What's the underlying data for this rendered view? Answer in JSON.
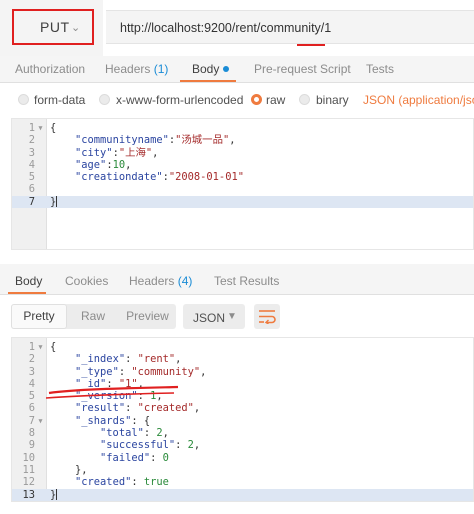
{
  "request": {
    "method": "PUT",
    "url": "http://localhost:9200/rent/community/1"
  },
  "request_tabs": [
    {
      "label": "Authorization"
    },
    {
      "label": "Headers",
      "count": "(1)"
    },
    {
      "label": "Body"
    },
    {
      "label": "Pre-request Script"
    },
    {
      "label": "Tests"
    }
  ],
  "body_types": {
    "form_data": "form-data",
    "urlencoded": "x-www-form-urlencoded",
    "raw": "raw",
    "binary": "binary",
    "content_type": "JSON (application/json)",
    "selected": "raw"
  },
  "request_body": {
    "line_numbers": [
      "1",
      "2",
      "3",
      "4",
      "5",
      "6",
      "7"
    ],
    "lines": [
      [
        {
          "t": "{",
          "c": "p"
        }
      ],
      [
        {
          "t": "    ",
          "c": "p"
        },
        {
          "t": "\"communityname\"",
          "c": "k"
        },
        {
          "t": ":",
          "c": "p"
        },
        {
          "t": "\"汤城一品\"",
          "c": "s"
        },
        {
          "t": ",",
          "c": "p"
        }
      ],
      [
        {
          "t": "    ",
          "c": "p"
        },
        {
          "t": "\"city\"",
          "c": "k"
        },
        {
          "t": ":",
          "c": "p"
        },
        {
          "t": "\"上海\"",
          "c": "s"
        },
        {
          "t": ",",
          "c": "p"
        }
      ],
      [
        {
          "t": "    ",
          "c": "p"
        },
        {
          "t": "\"age\"",
          "c": "k"
        },
        {
          "t": ":",
          "c": "p"
        },
        {
          "t": "10",
          "c": "n"
        },
        {
          "t": ",",
          "c": "p"
        }
      ],
      [
        {
          "t": "    ",
          "c": "p"
        },
        {
          "t": "\"creationdate\"",
          "c": "k"
        },
        {
          "t": ":",
          "c": "p"
        },
        {
          "t": "\"2008-01-01\"",
          "c": "s"
        }
      ],
      [],
      [
        {
          "t": "}",
          "c": "p"
        }
      ]
    ]
  },
  "response_tabs": [
    {
      "label": "Body"
    },
    {
      "label": "Cookies"
    },
    {
      "label": "Headers",
      "count": "(4)"
    },
    {
      "label": "Test Results"
    }
  ],
  "response_format": {
    "buttons": [
      "Pretty",
      "Raw",
      "Preview"
    ],
    "selected": "JSON"
  },
  "response_body": {
    "line_numbers": [
      "1",
      "2",
      "3",
      "4",
      "5",
      "6",
      "7",
      "8",
      "9",
      "10",
      "11",
      "12",
      "13"
    ],
    "lines": [
      [
        {
          "t": "{",
          "c": "p"
        }
      ],
      [
        {
          "t": "    ",
          "c": "p"
        },
        {
          "t": "\"_index\"",
          "c": "k"
        },
        {
          "t": ": ",
          "c": "p"
        },
        {
          "t": "\"rent\"",
          "c": "s"
        },
        {
          "t": ",",
          "c": "p"
        }
      ],
      [
        {
          "t": "    ",
          "c": "p"
        },
        {
          "t": "\"_type\"",
          "c": "k"
        },
        {
          "t": ": ",
          "c": "p"
        },
        {
          "t": "\"community\"",
          "c": "s"
        },
        {
          "t": ",",
          "c": "p"
        }
      ],
      [
        {
          "t": "    ",
          "c": "p"
        },
        {
          "t": "\"_id\"",
          "c": "k"
        },
        {
          "t": ": ",
          "c": "p"
        },
        {
          "t": "\"1\"",
          "c": "s"
        },
        {
          "t": ",",
          "c": "p"
        }
      ],
      [
        {
          "t": "    ",
          "c": "p"
        },
        {
          "t": "\"_version\"",
          "c": "k"
        },
        {
          "t": ": ",
          "c": "p"
        },
        {
          "t": "1",
          "c": "n"
        },
        {
          "t": ",",
          "c": "p"
        }
      ],
      [
        {
          "t": "    ",
          "c": "p"
        },
        {
          "t": "\"result\"",
          "c": "k"
        },
        {
          "t": ": ",
          "c": "p"
        },
        {
          "t": "\"created\"",
          "c": "s"
        },
        {
          "t": ",",
          "c": "p"
        }
      ],
      [
        {
          "t": "    ",
          "c": "p"
        },
        {
          "t": "\"_shards\"",
          "c": "k"
        },
        {
          "t": ": {",
          "c": "p"
        }
      ],
      [
        {
          "t": "        ",
          "c": "p"
        },
        {
          "t": "\"total\"",
          "c": "k"
        },
        {
          "t": ": ",
          "c": "p"
        },
        {
          "t": "2",
          "c": "n"
        },
        {
          "t": ",",
          "c": "p"
        }
      ],
      [
        {
          "t": "        ",
          "c": "p"
        },
        {
          "t": "\"successful\"",
          "c": "k"
        },
        {
          "t": ": ",
          "c": "p"
        },
        {
          "t": "2",
          "c": "n"
        },
        {
          "t": ",",
          "c": "p"
        }
      ],
      [
        {
          "t": "        ",
          "c": "p"
        },
        {
          "t": "\"failed\"",
          "c": "k"
        },
        {
          "t": ": ",
          "c": "p"
        },
        {
          "t": "0",
          "c": "n"
        }
      ],
      [
        {
          "t": "    },",
          "c": "p"
        }
      ],
      [
        {
          "t": "    ",
          "c": "p"
        },
        {
          "t": "\"created\"",
          "c": "k"
        },
        {
          "t": ": ",
          "c": "p"
        },
        {
          "t": "true",
          "c": "n"
        }
      ],
      [
        {
          "t": "}",
          "c": "p"
        }
      ]
    ]
  },
  "icons": {
    "method_dropdown": "chevron-down-icon",
    "select_dropdown": "chevron-down-icon",
    "wrap_lines": "wrap-lines-icon",
    "body_modified": "dot-indicator-icon"
  },
  "colors": {
    "accent": "#ef7b3f",
    "link_blue": "#1a8cd6",
    "annotation_red": "#e02020",
    "json_key": "#2b45a0",
    "json_string": "#a42a2a",
    "json_number": "#2a8a3a"
  }
}
